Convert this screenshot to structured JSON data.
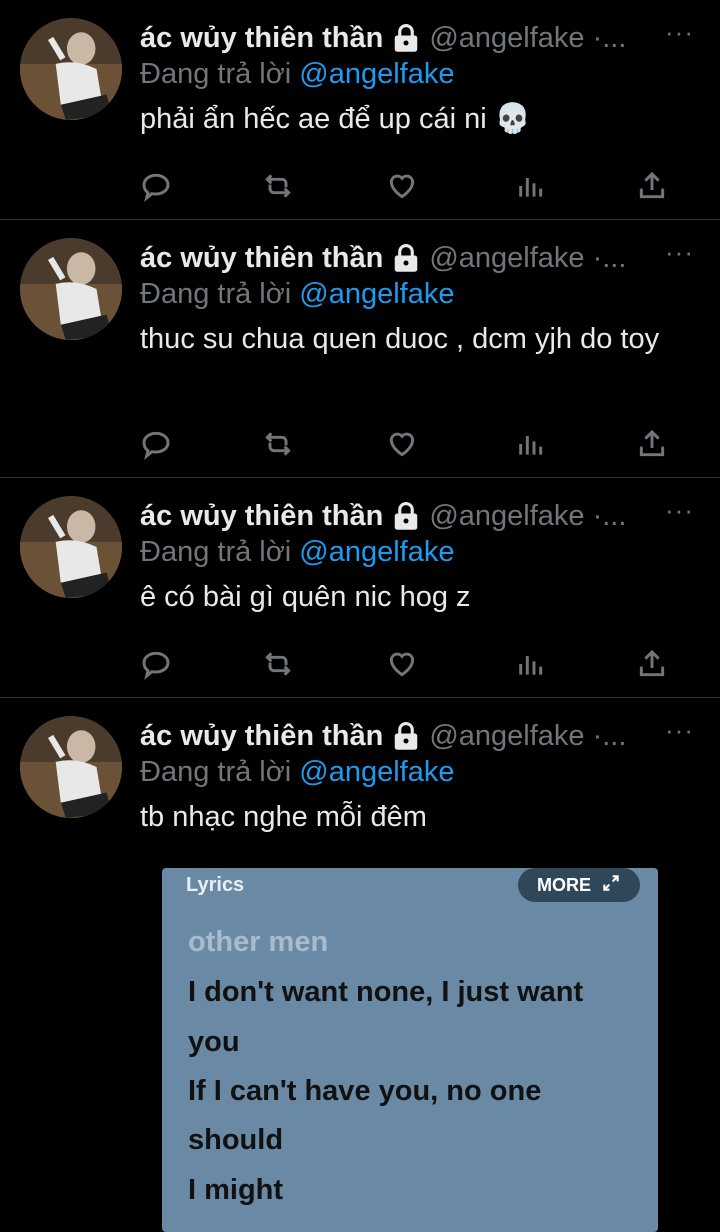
{
  "tweets": [
    {
      "name": "ác wủy thiên thần",
      "handle": "@angelfake ·...",
      "reply_prefix": "Đang trả lời",
      "reply_to": "@angelfake",
      "text": "phải ẩn hếc ae để up cái ni 💀"
    },
    {
      "name": "ác wủy thiên thần",
      "handle": "@angelfake ·...",
      "reply_prefix": "Đang trả lời",
      "reply_to": "@angelfake",
      "text": "thuc su chua quen duoc , dcm yjh do toy"
    },
    {
      "name": "ác wủy thiên thần",
      "handle": "@angelfake ·...",
      "reply_prefix": "Đang trả lời",
      "reply_to": "@angelfake",
      "text": "ê có bài gì quên nic hog z"
    },
    {
      "name": "ác wủy thiên thần",
      "handle": "@angelfake ·...",
      "reply_prefix": "Đang trả lời",
      "reply_to": "@angelfake",
      "text": "tb nhạc nghe mỗi đêm"
    }
  ],
  "more_label": "···",
  "lyrics_card": {
    "title": "Lyrics",
    "more": "MORE",
    "lines": [
      "other men",
      "I don't want none, I just want",
      "you",
      "If I can't have you, no one",
      "should",
      "I might"
    ]
  },
  "icons": [
    "reply-icon",
    "retweet-icon",
    "like-icon",
    "analytics-icon",
    "share-icon",
    "lock-icon",
    "expand-icon"
  ],
  "colors": {
    "link": "#1d9bf0",
    "muted": "#71767b",
    "background": "#000000",
    "lyrics_bg": "#6a89a5"
  }
}
